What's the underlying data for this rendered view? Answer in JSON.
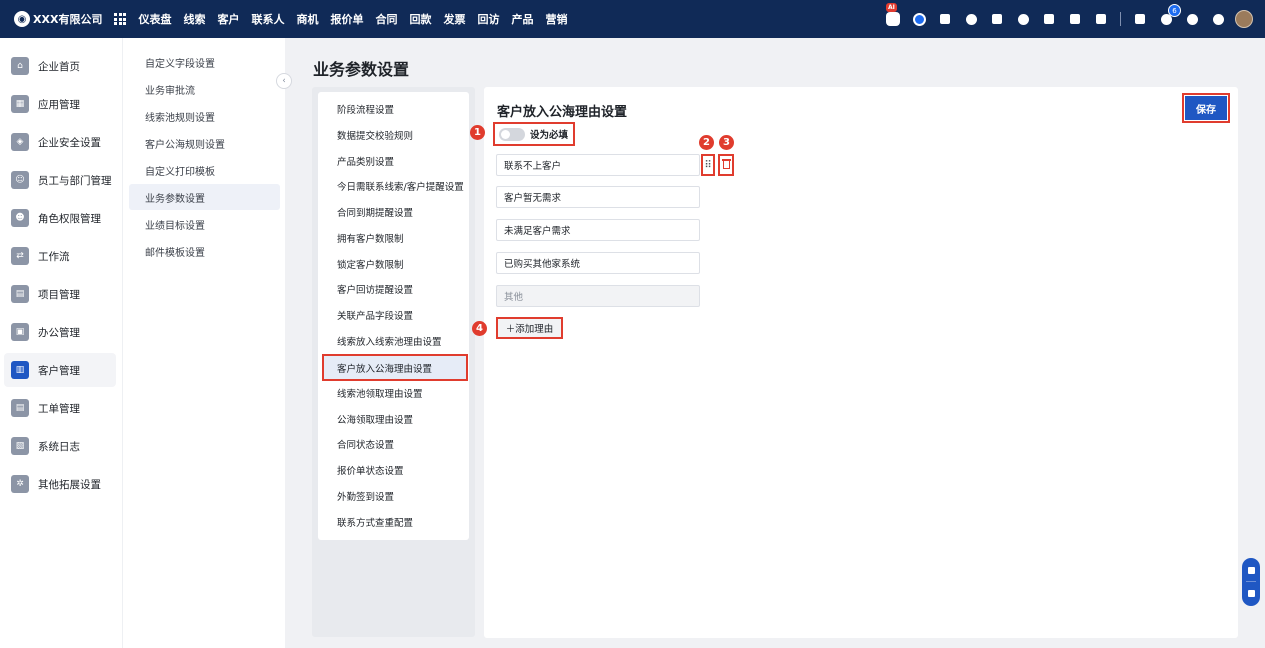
{
  "app": {
    "company": "XXX有限公司",
    "nav": [
      "仪表盘",
      "线索",
      "客户",
      "联系人",
      "商机",
      "报价单",
      "合同",
      "回款",
      "发票",
      "回访",
      "产品",
      "营销"
    ],
    "ai_badge": "AI",
    "notification_count": "6"
  },
  "leftnav": [
    {
      "label": "企业首页",
      "icon": "home-icon"
    },
    {
      "label": "应用管理",
      "icon": "apps-icon"
    },
    {
      "label": "企业安全设置",
      "icon": "shield-icon"
    },
    {
      "label": "员工与部门管理",
      "icon": "users-icon"
    },
    {
      "label": "角色权限管理",
      "icon": "role-icon"
    },
    {
      "label": "工作流",
      "icon": "workflow-icon"
    },
    {
      "label": "项目管理",
      "icon": "project-icon"
    },
    {
      "label": "办公管理",
      "icon": "office-icon"
    },
    {
      "label": "客户管理",
      "icon": "customer-icon"
    },
    {
      "label": "工单管理",
      "icon": "ticket-icon"
    },
    {
      "label": "系统日志",
      "icon": "log-icon"
    },
    {
      "label": "其他拓展设置",
      "icon": "settings-icon"
    }
  ],
  "subnav": [
    "自定义字段设置",
    "业务审批流",
    "线索池规则设置",
    "客户公海规则设置",
    "自定义打印模板",
    "业务参数设置",
    "业绩目标设置",
    "邮件模板设置"
  ],
  "page": {
    "title": "业务参数设置"
  },
  "settings_list": [
    "阶段流程设置",
    "数据提交校验规则",
    "产品类别设置",
    "今日需联系线索/客户提醒设置",
    "合同到期提醒设置",
    "拥有客户数限制",
    "锁定客户数限制",
    "客户回访提醒设置",
    "关联产品字段设置",
    "线索放入线索池理由设置",
    "客户放入公海理由设置",
    "线索池领取理由设置",
    "公海领取理由设置",
    "合同状态设置",
    "报价单状态设置",
    "外勤签到设置",
    "联系方式查重配置"
  ],
  "panel": {
    "title": "客户放入公海理由设置",
    "save_label": "保存",
    "required_label": "设为必填",
    "reasons": [
      "联系不上客户",
      "客户暂无需求",
      "未满足客户需求",
      "已购买其他家系统"
    ],
    "other_placeholder": "其他",
    "add_label": "＋添加理由",
    "markers": [
      "1",
      "2",
      "3",
      "4"
    ]
  },
  "colors": {
    "topbar": "#102a57",
    "accent": "#1f57c3",
    "highlight": "#e03c2e"
  }
}
